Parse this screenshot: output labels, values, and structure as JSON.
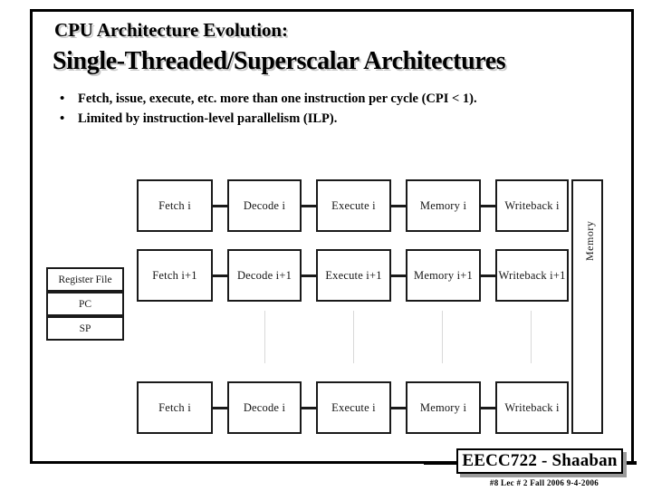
{
  "slide": {
    "title_line1": "CPU Architecture Evolution:",
    "title_line2": "Single-Threaded/Superscalar Architectures",
    "bullet_marker": "•",
    "bullets": [
      "Fetch, issue, execute, etc. more than one instruction per cycle (CPI < 1).",
      "Limited by instruction-level parallelism (ILP)."
    ]
  },
  "diagram": {
    "register_stack": [
      {
        "label": "Register File"
      },
      {
        "label": "PC"
      },
      {
        "label": "SP"
      }
    ],
    "memory_bar_label": "Memory",
    "rows": [
      {
        "row_name": "instruction-i-row-top",
        "stages": [
          {
            "name": "Fetch i"
          },
          {
            "name": "Decode i"
          },
          {
            "name": "Execute i"
          },
          {
            "name": "Memory i"
          },
          {
            "name": "Writeback i"
          }
        ]
      },
      {
        "row_name": "instruction-i-plus-1-row",
        "stages": [
          {
            "name": "Fetch i+1"
          },
          {
            "name": "Decode i+1"
          },
          {
            "name": "Execute i+1"
          },
          {
            "name": "Memory i+1"
          },
          {
            "name": "Writeback i+1"
          }
        ]
      },
      {
        "row_name": "instruction-i-row-bottom",
        "stages": [
          {
            "name": "Fetch i"
          },
          {
            "name": "Decode i"
          },
          {
            "name": "Execute i"
          },
          {
            "name": "Memory i"
          },
          {
            "name": "Writeback i"
          }
        ]
      }
    ]
  },
  "footer": {
    "course_label": "EECC722 - Shaaban",
    "sub_label": "#8   Lec # 2   Fall 2006  9-4-2006"
  },
  "colors": {
    "ink": "#000000",
    "box_border": "#1a1a1a",
    "title_shadow": "#c9c9c9",
    "dash_line": "#d9d9d9",
    "footer_shadow": "#9a9a9a",
    "page_background": "#ffffff"
  }
}
